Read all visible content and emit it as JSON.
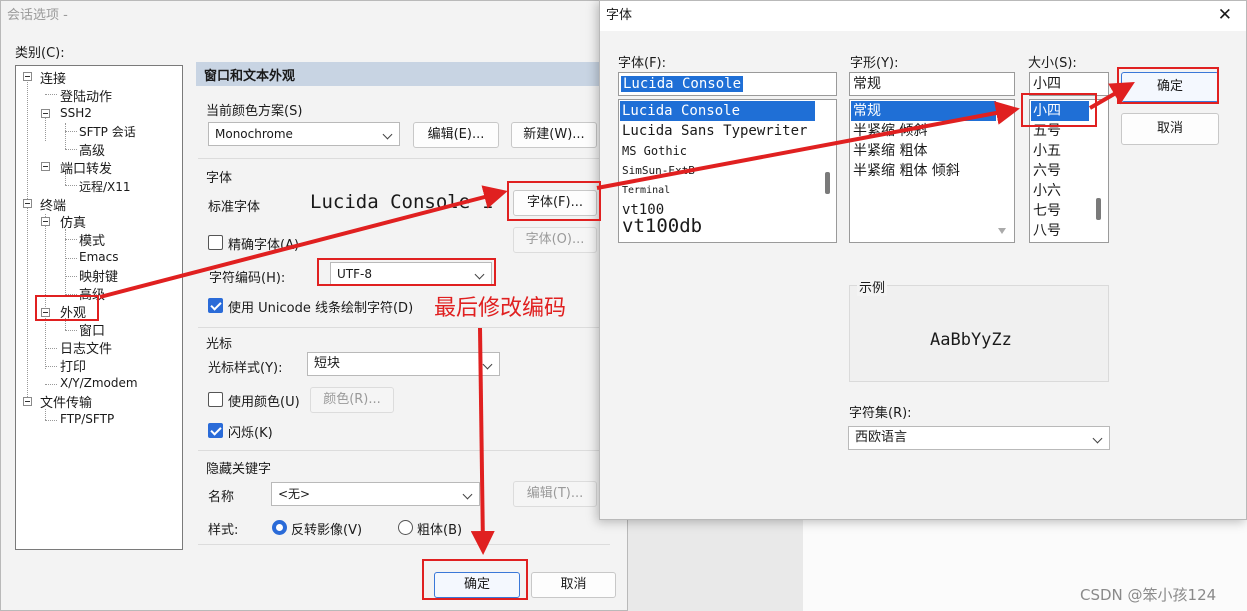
{
  "session": {
    "title": "会话选项 -",
    "category_label": "类别(C):",
    "tree": {
      "connection": "连接",
      "login_actions": "登陆动作",
      "ssh2": "SSH2",
      "sftp_session": "SFTP 会话",
      "advanced1": "高级",
      "port_forward": "端口转发",
      "remote_x11": "远程/X11",
      "terminal": "终端",
      "emulation": "仿真",
      "modes": "模式",
      "emacs": "Emacs",
      "mapped_keys": "映射键",
      "advanced2": "高级",
      "appearance": "外观",
      "window": "窗口",
      "log_file": "日志文件",
      "printing": "打印",
      "xyzmodem": "X/Y/Zmodem",
      "file_transfer": "文件传输",
      "ftp_sftp": "FTP/SFTP"
    },
    "panel_title": "窗口和文本外观",
    "color_scheme_label": "当前颜色方案(S)",
    "color_scheme_value": "Monochrome",
    "edit_button": "编辑(E)...",
    "new_button": "新建(W)...",
    "font_section": "字体",
    "normal_font_label": "标准字体",
    "normal_font_preview": "Lucida Console 1",
    "font_button": "字体(F)...",
    "precise_font_label": "精确字体(A)",
    "precise_font_button": "字体(O)...",
    "encoding_label": "字符编码(H):",
    "encoding_value": "UTF-8",
    "unicode_line_label": "使用 Unicode 线条绘制字符(D)",
    "annotation": "最后修改编码",
    "cursor_section": "光标",
    "cursor_style_label": "光标样式(Y):",
    "cursor_style_value": "短块",
    "use_color_label": "使用颜色(U)",
    "color_button": "颜色(R)...",
    "blink_label": "闪烁(K)",
    "hidden_keywords_section": "隐藏关键字",
    "name_label": "名称",
    "name_value": "<无>",
    "edit_t_button": "编辑(T)...",
    "style_label": "样式:",
    "reverse_label": "反转影像(V)",
    "bold_label": "粗体(B)",
    "ok_button": "确定",
    "cancel_button": "取消"
  },
  "font_dialog": {
    "title": "字体",
    "close_glyph": "✕",
    "font_label": "字体(F):",
    "font_value": "Lucida Console",
    "font_list": [
      "Lucida Console",
      "Lucida Sans Typewriter",
      "MS Gothic",
      "SimSun-ExtB",
      "Terminal",
      "vt100",
      "vt100db"
    ],
    "style_label": "字形(Y):",
    "style_value": "常规",
    "style_list": [
      "常规",
      "半紧缩 倾斜",
      "半紧缩 粗体",
      "半紧缩 粗体 倾斜"
    ],
    "size_label": "大小(S):",
    "size_value": "小四",
    "size_list": [
      "小四",
      "五号",
      "小五",
      "六号",
      "小六",
      "七号",
      "八号"
    ],
    "ok_button": "确定",
    "cancel_button": "取消",
    "sample_label": "示例",
    "sample_text": "AaBbYyZz",
    "charset_label": "字符集(R):",
    "charset_value": "西欧语言"
  },
  "watermark": "CSDN @笨小孩124",
  "colors": {
    "highlight_red": "#e02020",
    "accent_blue": "#1f6fd6"
  }
}
